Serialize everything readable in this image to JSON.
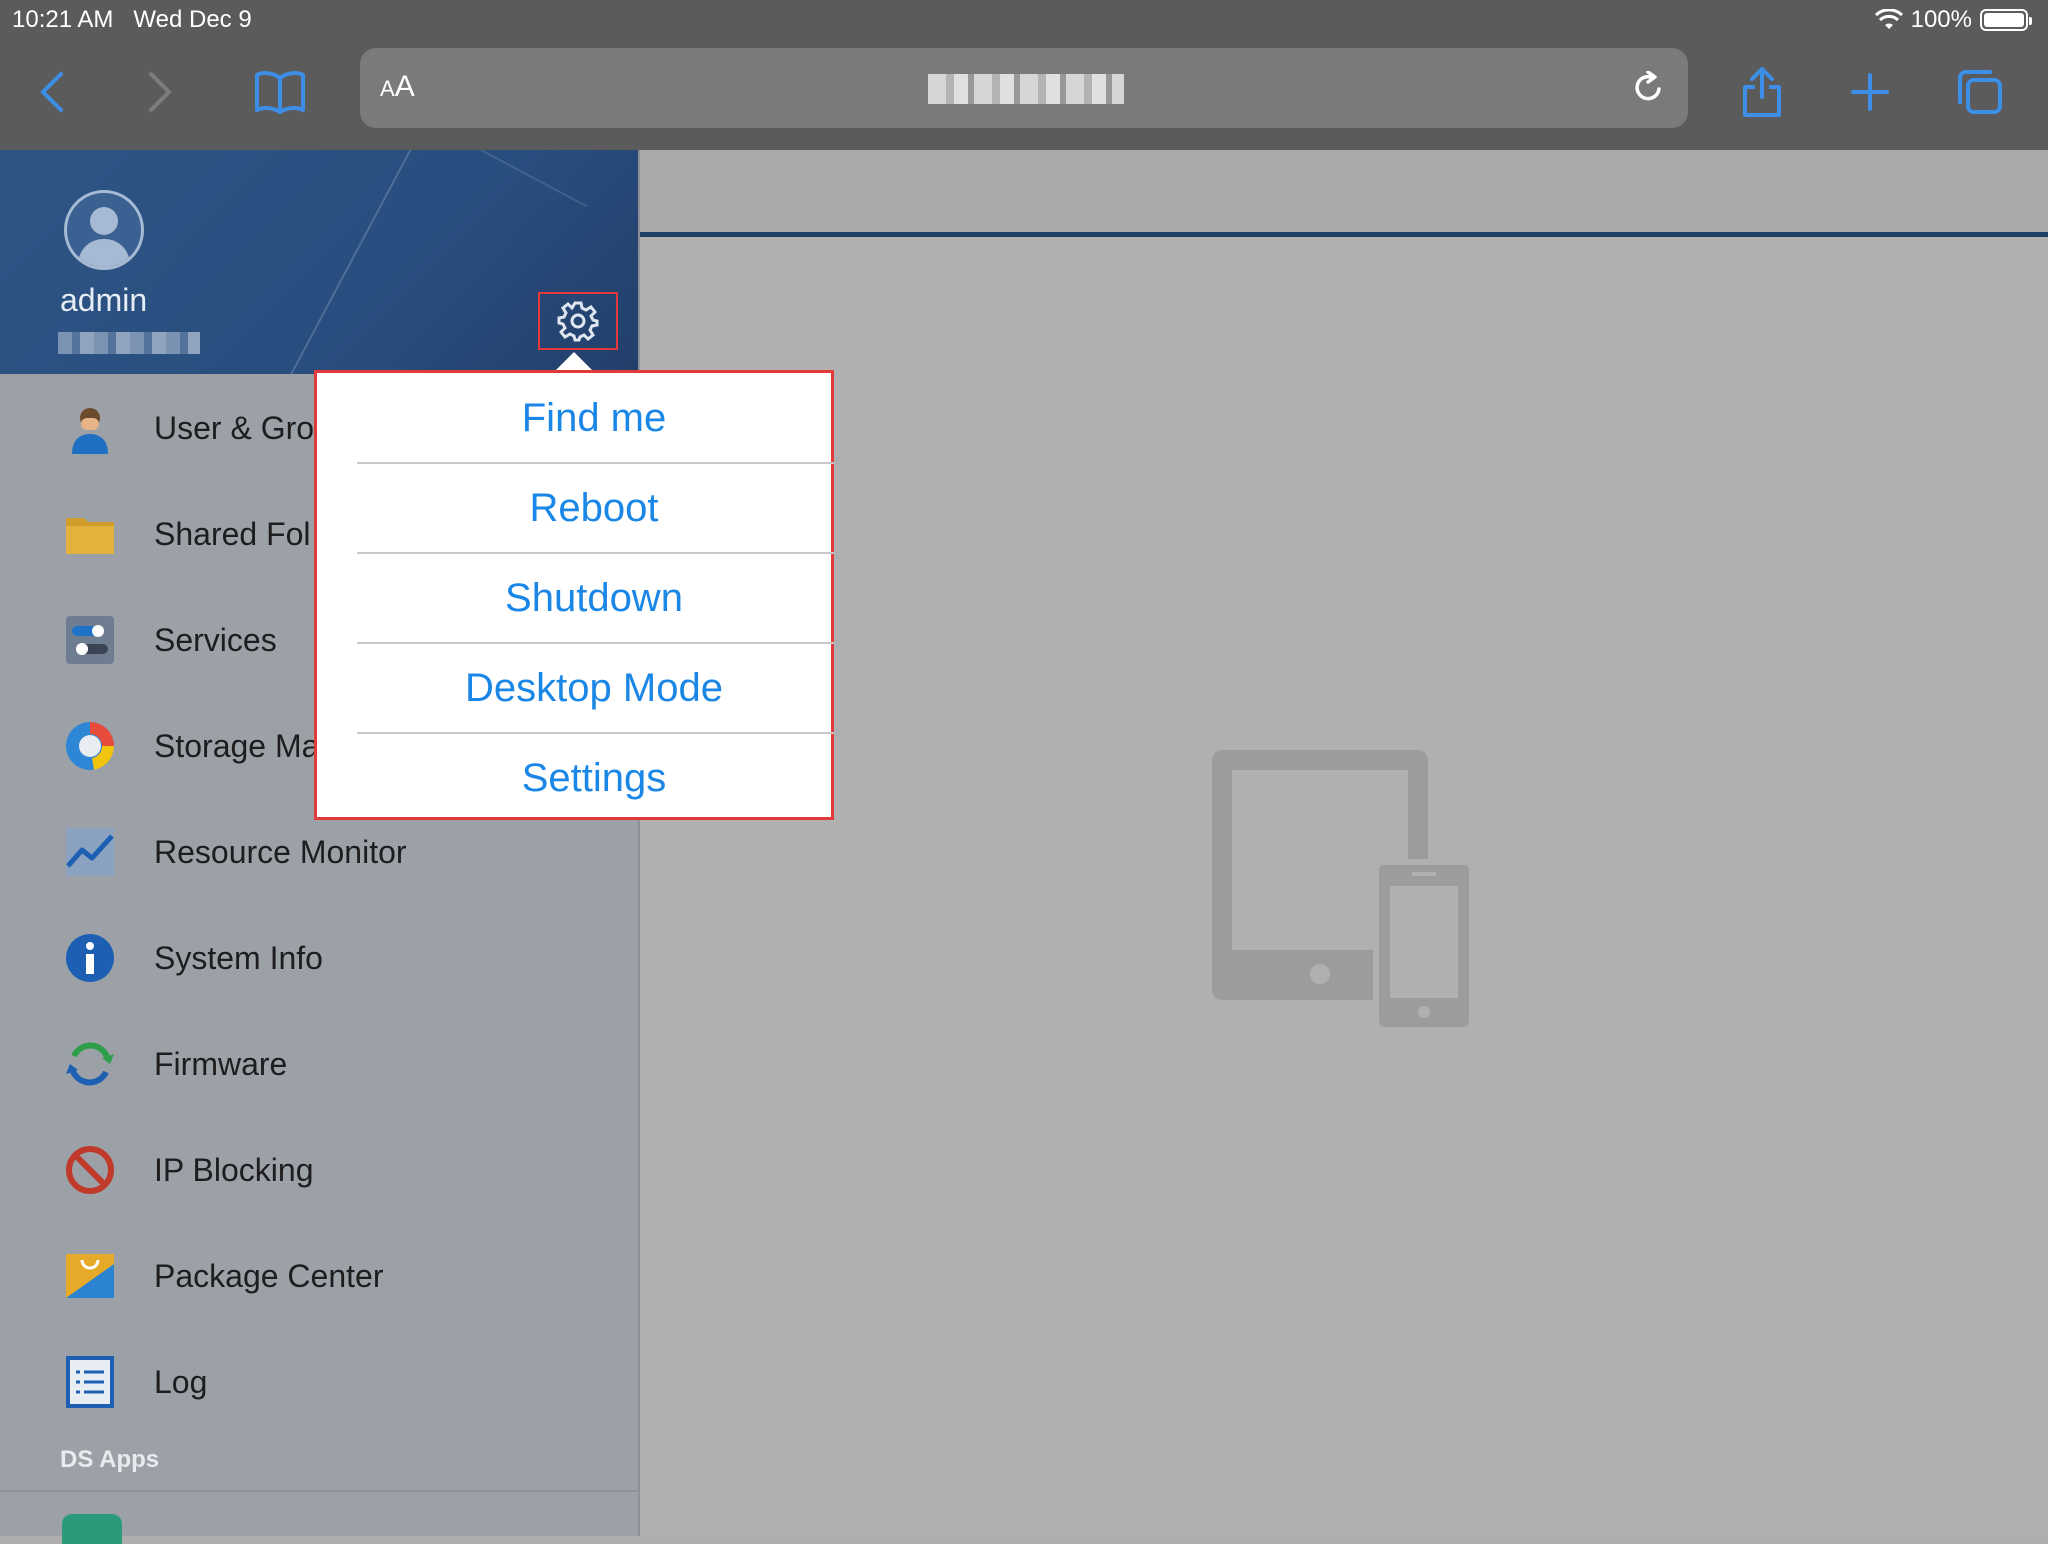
{
  "status_bar": {
    "time": "10:21 AM",
    "date": "Wed Dec 9",
    "battery": "100%",
    "wifi_icon": "wifi-icon"
  },
  "browser": {
    "address_aa_small": "A",
    "address_aa_big": "A",
    "icons": [
      "back-icon",
      "forward-icon",
      "bookmarks-icon",
      "reload-icon",
      "share-icon",
      "new-tab-icon",
      "tabs-icon"
    ]
  },
  "profile": {
    "name": "admin"
  },
  "sidebar": {
    "items": [
      {
        "label": "User & Gro",
        "icon": "user-group-icon"
      },
      {
        "label": "Shared Fol",
        "icon": "folder-icon"
      },
      {
        "label": "Services",
        "icon": "services-icon"
      },
      {
        "label": "Storage Ma",
        "icon": "storage-icon"
      },
      {
        "label": "Resource Monitor",
        "icon": "chart-icon"
      },
      {
        "label": "System Info",
        "icon": "info-icon"
      },
      {
        "label": "Firmware",
        "icon": "refresh-icon"
      },
      {
        "label": "IP Blocking",
        "icon": "block-icon"
      },
      {
        "label": "Package Center",
        "icon": "package-icon"
      },
      {
        "label": "Log",
        "icon": "log-icon"
      }
    ],
    "section_title": "DS Apps"
  },
  "popover": {
    "items": [
      "Find me",
      "Reboot",
      "Shutdown",
      "Desktop Mode",
      "Settings"
    ],
    "accent": "#1a86e6",
    "highlight": "#e23a3a"
  }
}
